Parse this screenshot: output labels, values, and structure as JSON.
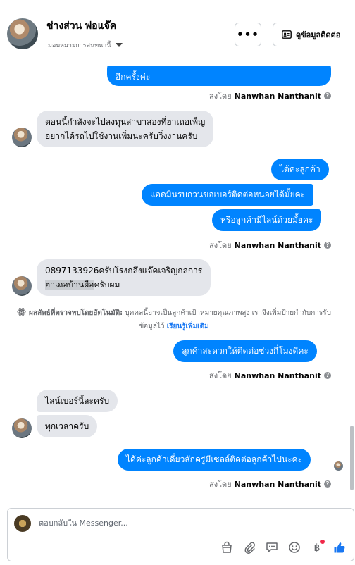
{
  "header": {
    "name": "ช่างส่วน พ่อแจ๊ค",
    "assign_label": "มอบหมายการสนทนานี้",
    "more_label": "•••",
    "contact_label": "ดูข้อมูลติดต่อ"
  },
  "messages": {
    "m1": "อีกครั้งค่ะ",
    "sent_by_1": "ส่งโดย",
    "sender_1": "Nanwhan Nanthanit",
    "m2_line1": "ตอนนี้กำลังจะไปลงทุนสาขาสองที่ฮาเถอเพ็ญ",
    "m2_line2": "อยากได้รถไปใช้งานเพิ่มนะครับวิ่งงานครับ",
    "m3": "ได้ค่ะลูกค้า",
    "m4": "แอดมินรบกวนขอเบอร์ติดต่อหน่อยได้มั้ยคะ",
    "m5": "หรือลูกค้ามีไลน์ด้วยมั้ยคะ",
    "sent_by_2": "ส่งโดย",
    "sender_2": "Nanwhan Nanthanit",
    "m6_line1": "0897133926ครับโรงกลึงแจ๊คเจริญกลการ",
    "m6_line2_highlight": "ฮาเถอบ้านผือ",
    "m6_line2_rest": "ครับผม",
    "auto_note_bold": "ผลลัพธ์ที่ตรวจพบโดยอัตโนมัติ:",
    "auto_note_text": " บุคคลนี้อาจเป็นลูกค้าเป้าหมายคุณภาพสูง เราจึงเพิ่มป้ายกำกับการรับข้อมูลไว้ ",
    "auto_note_link": "เรียนรู้เพิ่มเติม",
    "m7": "ลูกค้าสะดวกให้ติดต่อช่วงกี่โมงดีคะ",
    "sent_by_3": "ส่งโดย",
    "sender_3": "Nanwhan Nanthanit",
    "m8": "ไลน์เบอร์นี้ละครับ",
    "m9": "ทุกเวลาครับ",
    "m10": "ได้ค่ะลูกค้าเดี๋ยวสักครู่มีเซลล์ติดต่อลูกค้าไปนะคะ",
    "sent_by_4": "ส่งโดย",
    "sender_4": "Nanwhan Nanthanit"
  },
  "composer": {
    "placeholder": "ตอบกลับใน Messenger..."
  },
  "colors": {
    "outgoing_bubble": "#0084ff",
    "incoming_bubble": "#e4e6eb",
    "link": "#1877f2",
    "like": "#1877f2"
  }
}
